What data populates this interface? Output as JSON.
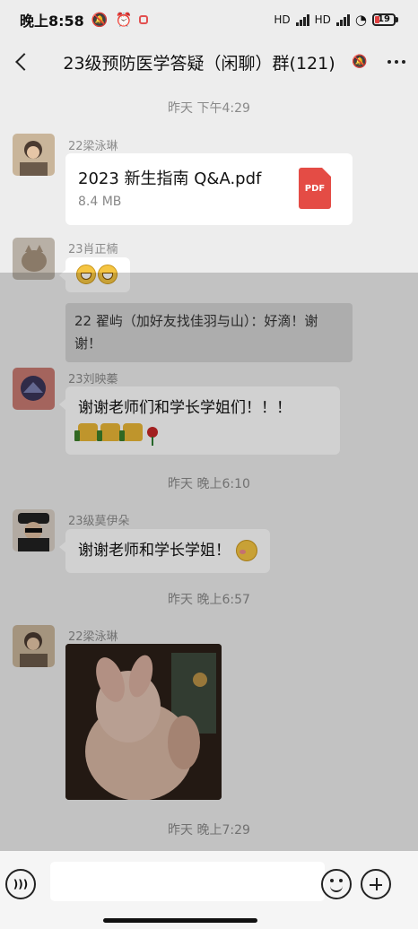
{
  "status_bar": {
    "time": "晚上8:58",
    "signal1": "HD",
    "signal2": "HD",
    "battery": "19"
  },
  "header": {
    "title": "23级预防医学答疑（闲聊）群(121)"
  },
  "messages": {
    "ts1": "昨天 下午4:29",
    "m1_sender": "22梁泳琳",
    "m1_file_name": "2023 新生指南 Q&A.pdf",
    "m1_file_size": "8.4 MB",
    "m1_file_type": "PDF",
    "m2_sender": "23肖正楠",
    "system_msg": "22 翟屿（加好友找佳羽与山）：好滴！谢谢！",
    "m3_sender": "23刘映蓁",
    "m3_text": "谢谢老师们和学长学姐们！！！",
    "ts2": "昨天 晚上6:10",
    "m4_sender": "23级莫伊朵",
    "m4_text": "谢谢老师和学长学姐！",
    "ts3": "昨天 晚上6:57",
    "m5_sender": "22梁泳琳",
    "ts4": "昨天 晚上7:29"
  },
  "input": {
    "voice_icon": "voice-icon",
    "emoji_icon": "emoji-icon",
    "plus_icon": "plus-icon"
  }
}
